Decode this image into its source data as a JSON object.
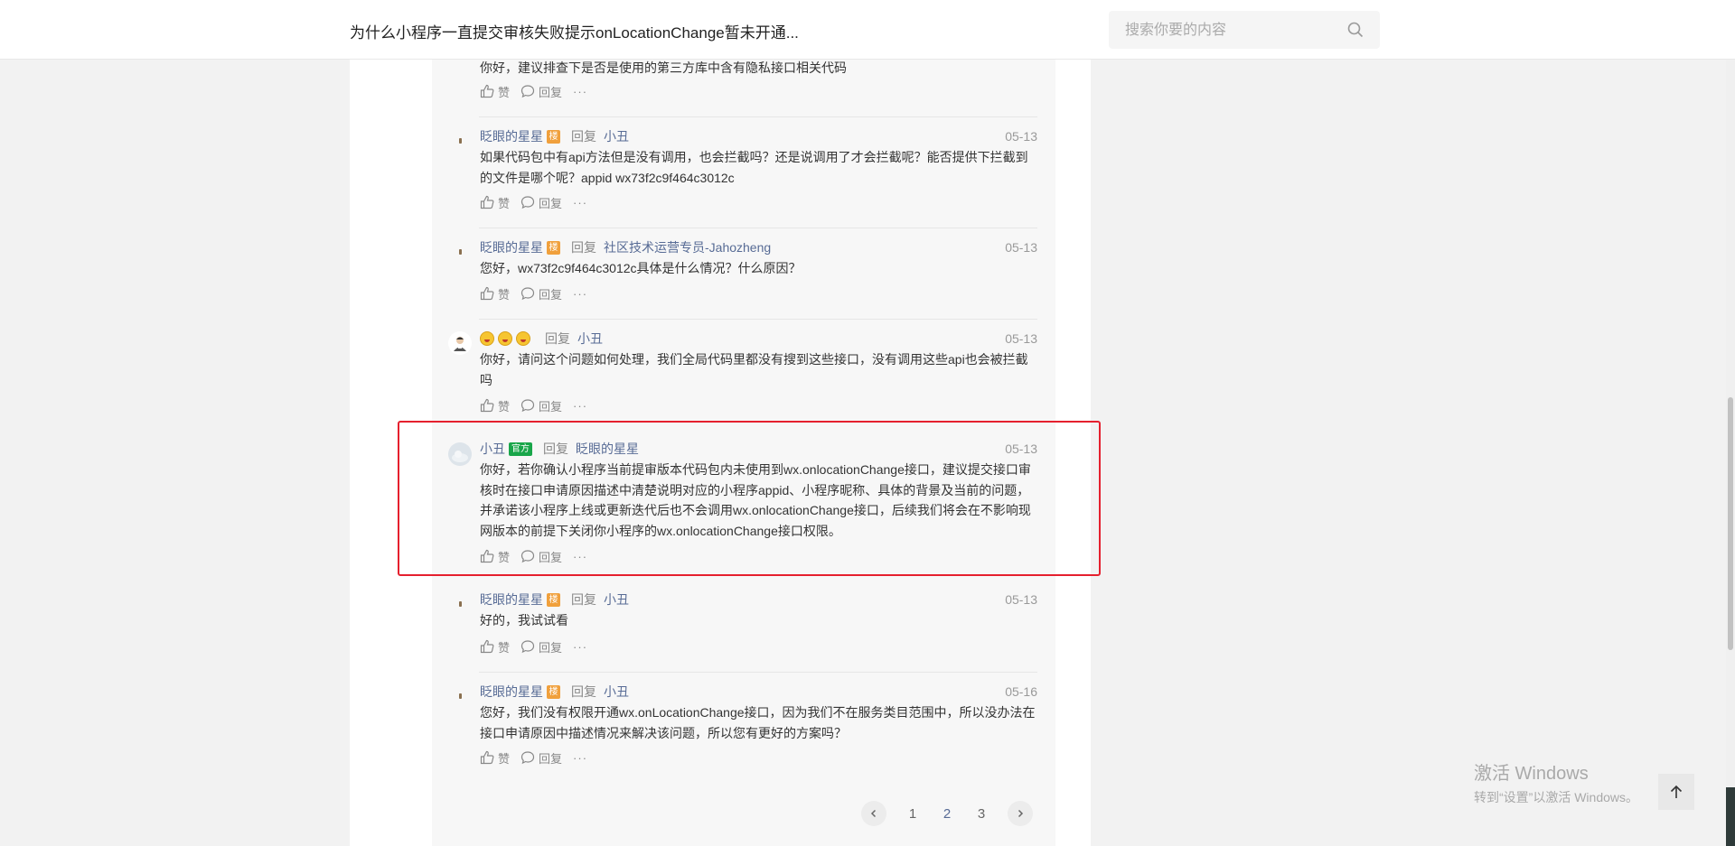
{
  "header": {
    "title": "为什么小程序一直提交审核失败提示onLocationChange暂未开通...",
    "search_placeholder": "搜索你要的内容"
  },
  "labels": {
    "like": "赞",
    "reply": "回复",
    "reply_to": "回复",
    "more": "···",
    "badge_floor": "楼",
    "badge_official": "官方"
  },
  "comments": [
    {
      "text": "你好，建议排查下是否是使用的第三方库中含有隐私接口相关代码"
    },
    {
      "author": "眨眼的星星",
      "target": "小丑",
      "date": "05-13",
      "text": "如果代码包中有api方法但是没有调用，也会拦截吗？还是说调用了才会拦截呢？能否提供下拦截到的文件是哪个呢？appid wx73f2c9f464c3012c"
    },
    {
      "author": "眨眼的星星",
      "target": "社区技术运营专员-Jahozheng",
      "date": "05-13",
      "text": "您好，wx73f2c9f464c3012c具体是什么情况？什么原因？"
    },
    {
      "emoji": [
        "grinning-face",
        "grinning-face",
        "grinning-face"
      ],
      "target": "小丑",
      "date": "05-13",
      "text": "你好，请问这个问题如何处理，我们全局代码里都没有搜到这些接口，没有调用这些api也会被拦截吗"
    },
    {
      "author": "小丑",
      "target": "眨眼的星星",
      "date": "05-13",
      "text": "你好，若你确认小程序当前提审版本代码包内未使用到wx.onlocationChange接口，建议提交接口审核时在接口申请原因描述中清楚说明对应的小程序appid、小程序昵称、具体的背景及当前的问题，并承诺该小程序上线或更新迭代后也不会调用wx.onlocationChange接口，后续我们将会在不影响现网版本的前提下关闭你小程序的wx.onlocationChange接口权限。"
    },
    {
      "author": "眨眼的星星",
      "target": "小丑",
      "date": "05-13",
      "text": "好的，我试试看"
    },
    {
      "author": "眨眼的星星",
      "target": "小丑",
      "date": "05-16",
      "text": "您好，我们没有权限开通wx.onLocationChange接口，因为我们不在服务类目范围中，所以没办法在接口申请原因中描述情况来解决该问题，所以您有更好的方案吗？"
    }
  ],
  "pagination": {
    "pages": [
      "1",
      "2",
      "3"
    ],
    "current": "2"
  },
  "watermark": {
    "line1": "激活 Windows",
    "line2": "转到“设置”以激活 Windows。"
  },
  "colors": {
    "link": "#576b95",
    "highlight": "#e5202e",
    "badge_floor": "#f0a03c",
    "badge_official": "#19a64a"
  }
}
